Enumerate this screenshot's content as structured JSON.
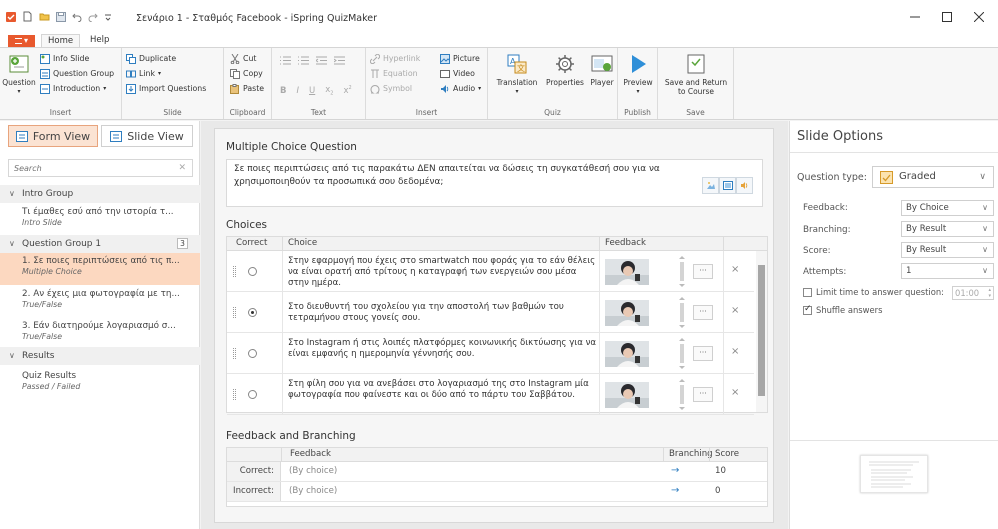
{
  "window": {
    "title": "Σενάριο 1 - Σταθμός Facebook - iSpring QuizMaker",
    "minimize_icon": "minimize-icon",
    "maximize_icon": "maximize-icon",
    "close_icon": "close-icon"
  },
  "tabs": {
    "file_label": "▾",
    "items": [
      "Home",
      "Help"
    ],
    "active": "Home"
  },
  "ribbon": {
    "insert": {
      "question_label": "Question",
      "info_slide": "Info Slide",
      "question_group": "Question Group",
      "introduction": "Introduction",
      "group_label": "Insert"
    },
    "slide": {
      "duplicate": "Duplicate",
      "link": "Link",
      "import_questions": "Import Questions",
      "group_label": "Slide"
    },
    "clipboard": {
      "cut": "Cut",
      "copy": "Copy",
      "paste": "Paste",
      "group_label": "Clipboard"
    },
    "text": {
      "group_label": "Text"
    },
    "insert2": {
      "hyperlink": "Hyperlink",
      "equation": "Equation",
      "symbol": "Symbol",
      "picture": "Picture",
      "video": "Video",
      "audio": "Audio",
      "group_label": "Insert"
    },
    "quiz": {
      "translation": "Translation",
      "properties": "Properties",
      "player": "Player",
      "group_label": "Quiz"
    },
    "publish": {
      "preview": "Preview",
      "group_label": "Publish"
    },
    "save": {
      "save_return": "Save and Return to Course",
      "group_label": "Save"
    }
  },
  "left_panel": {
    "form_view": "Form View",
    "slide_view": "Slide View",
    "search_placeholder": "Search",
    "groups": [
      {
        "title": "Intro Group",
        "items": [
          {
            "title": "Τι έμαθες εσύ από την ιστορία τ...",
            "subtitle": "Intro Slide"
          }
        ]
      },
      {
        "title": "Question Group 1",
        "count": "3",
        "items": [
          {
            "title": "1. Σε ποιες περιπτώσεις από τις π...",
            "subtitle": "Multiple Choice",
            "selected": true
          },
          {
            "title": "2. Αν έχεις μια φωτογραφία με τη...",
            "subtitle": "True/False"
          },
          {
            "title": "3. Εάν διατηρούμε λογαριασμό σ...",
            "subtitle": "True/False"
          }
        ]
      },
      {
        "title": "Results",
        "items": [
          {
            "title": "Quiz Results",
            "subtitle": "Passed / Failed"
          }
        ]
      }
    ]
  },
  "editor": {
    "question_header": "Multiple Choice Question",
    "question_text": "Σε ποιες περιπτώσεις από τις παρακάτω ΔΕΝ απαιτείται να δώσεις τη συγκατάθεσή σου για να χρησιμοποιηθούν τα προσωπικά σου δεδομένα;",
    "choices_header": "Choices",
    "columns": {
      "correct": "Correct",
      "choice": "Choice",
      "feedback": "Feedback"
    },
    "choices": [
      {
        "text": "Στην εφαρμογή που έχεις στο smartwatch που φοράς για το εάν θέλεις να είναι ορατή από τρίτους η καταγραφή των ενεργειών σου μέσα στην ημέρα.",
        "selected": false
      },
      {
        "text": "Στο διευθυντή του σχολείου για την αποστολή των βαθμών του τετραμήνου στους γονείς σου.",
        "selected": true
      },
      {
        "text": "Στο Instagram ή στις λοιπές πλατφόρμες κοινωνικής δικτύωσης για να είναι εμφανής η ημερομηνία γέννησής σου.",
        "selected": false
      },
      {
        "text": "Στη φίλη σου για να ανεβάσει στο λογαριασμό της στο Instagram μία φωτογραφία που φαίνεστε και οι δύο από το πάρτυ του Σαββάτου.",
        "selected": false
      }
    ],
    "dots_label": "···",
    "delete_label": "×",
    "fb_branching_header": "Feedback and Branching",
    "fb_columns": {
      "feedback": "Feedback",
      "branching": "Branching",
      "score": "Score"
    },
    "fb_rows": [
      {
        "label": "Correct:",
        "feedback": "(By choice)",
        "branch": "→",
        "score": "10"
      },
      {
        "label": "Incorrect:",
        "feedback": "(By choice)",
        "branch": "→",
        "score": "0"
      }
    ]
  },
  "slide_options": {
    "title": "Slide Options",
    "question_type_label": "Question type:",
    "question_type_value": "Graded",
    "feedback_label": "Feedback:",
    "feedback_value": "By Choice",
    "branching_label": "Branching:",
    "branching_value": "By Result",
    "score_label": "Score:",
    "score_value": "By Result",
    "attempts_label": "Attempts:",
    "attempts_value": "1",
    "limit_time_label": "Limit time to answer question:",
    "limit_time_value": "01:00",
    "limit_time_checked": false,
    "shuffle_label": "Shuffle answers",
    "shuffle_checked": true
  },
  "colors": {
    "accent_orange": "#e8592e",
    "selection_bg": "#fcd8c0",
    "link_blue": "#2f7ec0"
  }
}
